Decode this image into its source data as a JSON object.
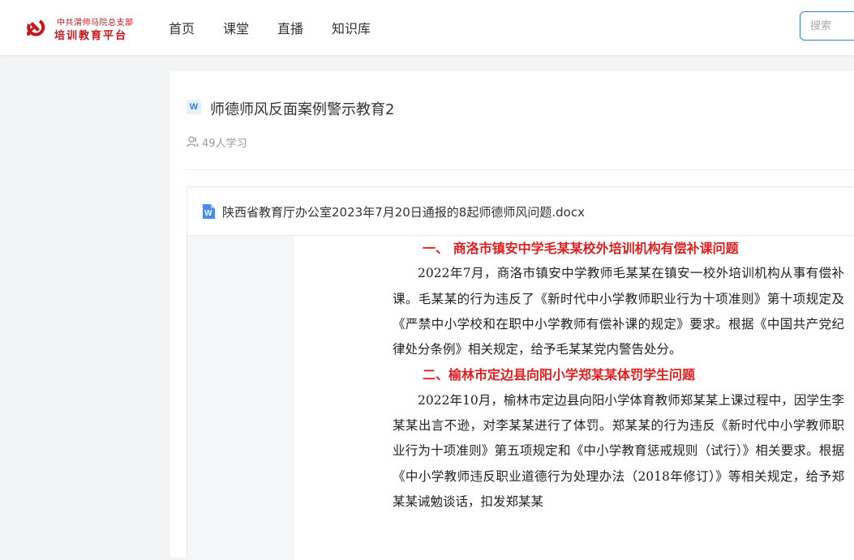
{
  "header": {
    "logo_line1": "中共渭师马院总支部",
    "logo_line2": "培训教育平台",
    "nav": [
      {
        "label": "首页"
      },
      {
        "label": "课堂"
      },
      {
        "label": "直播"
      },
      {
        "label": "知识库"
      }
    ],
    "search_placeholder": "搜索"
  },
  "course": {
    "badge": "W",
    "title": "师德师风反面案例警示教育2",
    "learners": "49人学习"
  },
  "viewer": {
    "file_name": "陕西省教育厅办公室2023年7月20日通报的8起师德师风问题.docx",
    "heading1": "一、  商洛市镇安中学毛某某校外培训机构有偿补课问题",
    "para1": "2022年7月，商洛市镇安中学教师毛某某在镇安一校外培训机构从事有偿补课。毛某某的行为违反了《新时代中小学教师职业行为十项准则》第十项规定及《严禁中小学校和在职中小学教师有偿补课的规定》要求。根据《中国共产党纪律处分条例》相关规定，给予毛某某党内警告处分。",
    "heading2": "二、榆林市定边县向阳小学郑某某体罚学生问题",
    "para2": "2022年10月，榆林市定边县向阳小学体育教师郑某某上课过程中，因学生李某某出言不逊，对李某某进行了体罚。郑某某的行为违反《新时代中小学教师职业行为十项准则》第五项规定和《中小学教育惩戒规则（试行）》相关要求。根据《中小学教师违反职业道德行为处理办法（2018年修订）》等相关规定，给予郑某某诫勉谈话，扣发郑某某"
  },
  "colors": {
    "brand_red": "#c8161d",
    "heading_red": "#e02020",
    "search_border": "#3a7bd5",
    "word_blue": "#2b7de9"
  }
}
